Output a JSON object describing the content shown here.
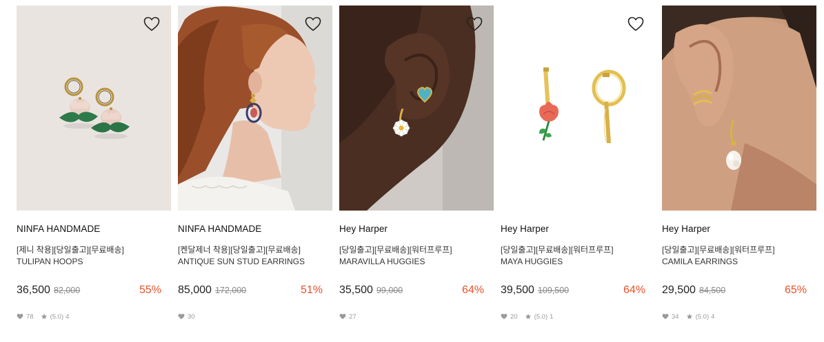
{
  "products": [
    {
      "brand": "NINFA HANDMADE",
      "tags": "[제니 착용][당일출고][무료배송]",
      "name": "TULIPAN HOOPS",
      "price": "36,500",
      "original_price": "82,000",
      "discount": "55%",
      "likes": "78",
      "rating": "(5.0)",
      "reviews": "4",
      "image": "tulip-hoop-earrings-on-pink-background"
    },
    {
      "brand": "NINFA HANDMADE",
      "tags": "[켄달제너 착용][당일출고][무료배송]",
      "name": "ANTIQUE SUN STUD EARRINGS",
      "price": "85,000",
      "original_price": "172,000",
      "discount": "51%",
      "likes": "30",
      "image": "model-profile-wearing-sun-earrings"
    },
    {
      "brand": "Hey Harper",
      "tags": "[당일출고][무료배송][워터프루프]",
      "name": "MARAVILLA HUGGIES",
      "price": "35,500",
      "original_price": "99,000",
      "discount": "64%",
      "likes": "27",
      "image": "ear-with-daisy-huggie-and-heart-stud"
    },
    {
      "brand": "Hey Harper",
      "tags": "[당일출고][무료배송][워터프루프]",
      "name": "MAYA HUGGIES",
      "price": "39,500",
      "original_price": "109,500",
      "discount": "64%",
      "likes": "20",
      "rating": "(5.0)",
      "reviews": "1",
      "image": "rose-huggie-earrings-on-white"
    },
    {
      "brand": "Hey Harper",
      "tags": "[당일출고][무료배송][워터프루프]",
      "name": "CAMILA EARRINGS",
      "price": "29,500",
      "original_price": "84,500",
      "discount": "65%",
      "likes": "34",
      "rating": "(5.0)",
      "reviews": "4",
      "image": "ear-with-pearl-drop-earring"
    }
  ],
  "icons": {
    "wishlist": "heart-outline-icon",
    "likes": "heart-filled-icon",
    "rating": "star-icon"
  },
  "colors": {
    "discount": "#e8502a",
    "muted": "#9a9a9a"
  }
}
